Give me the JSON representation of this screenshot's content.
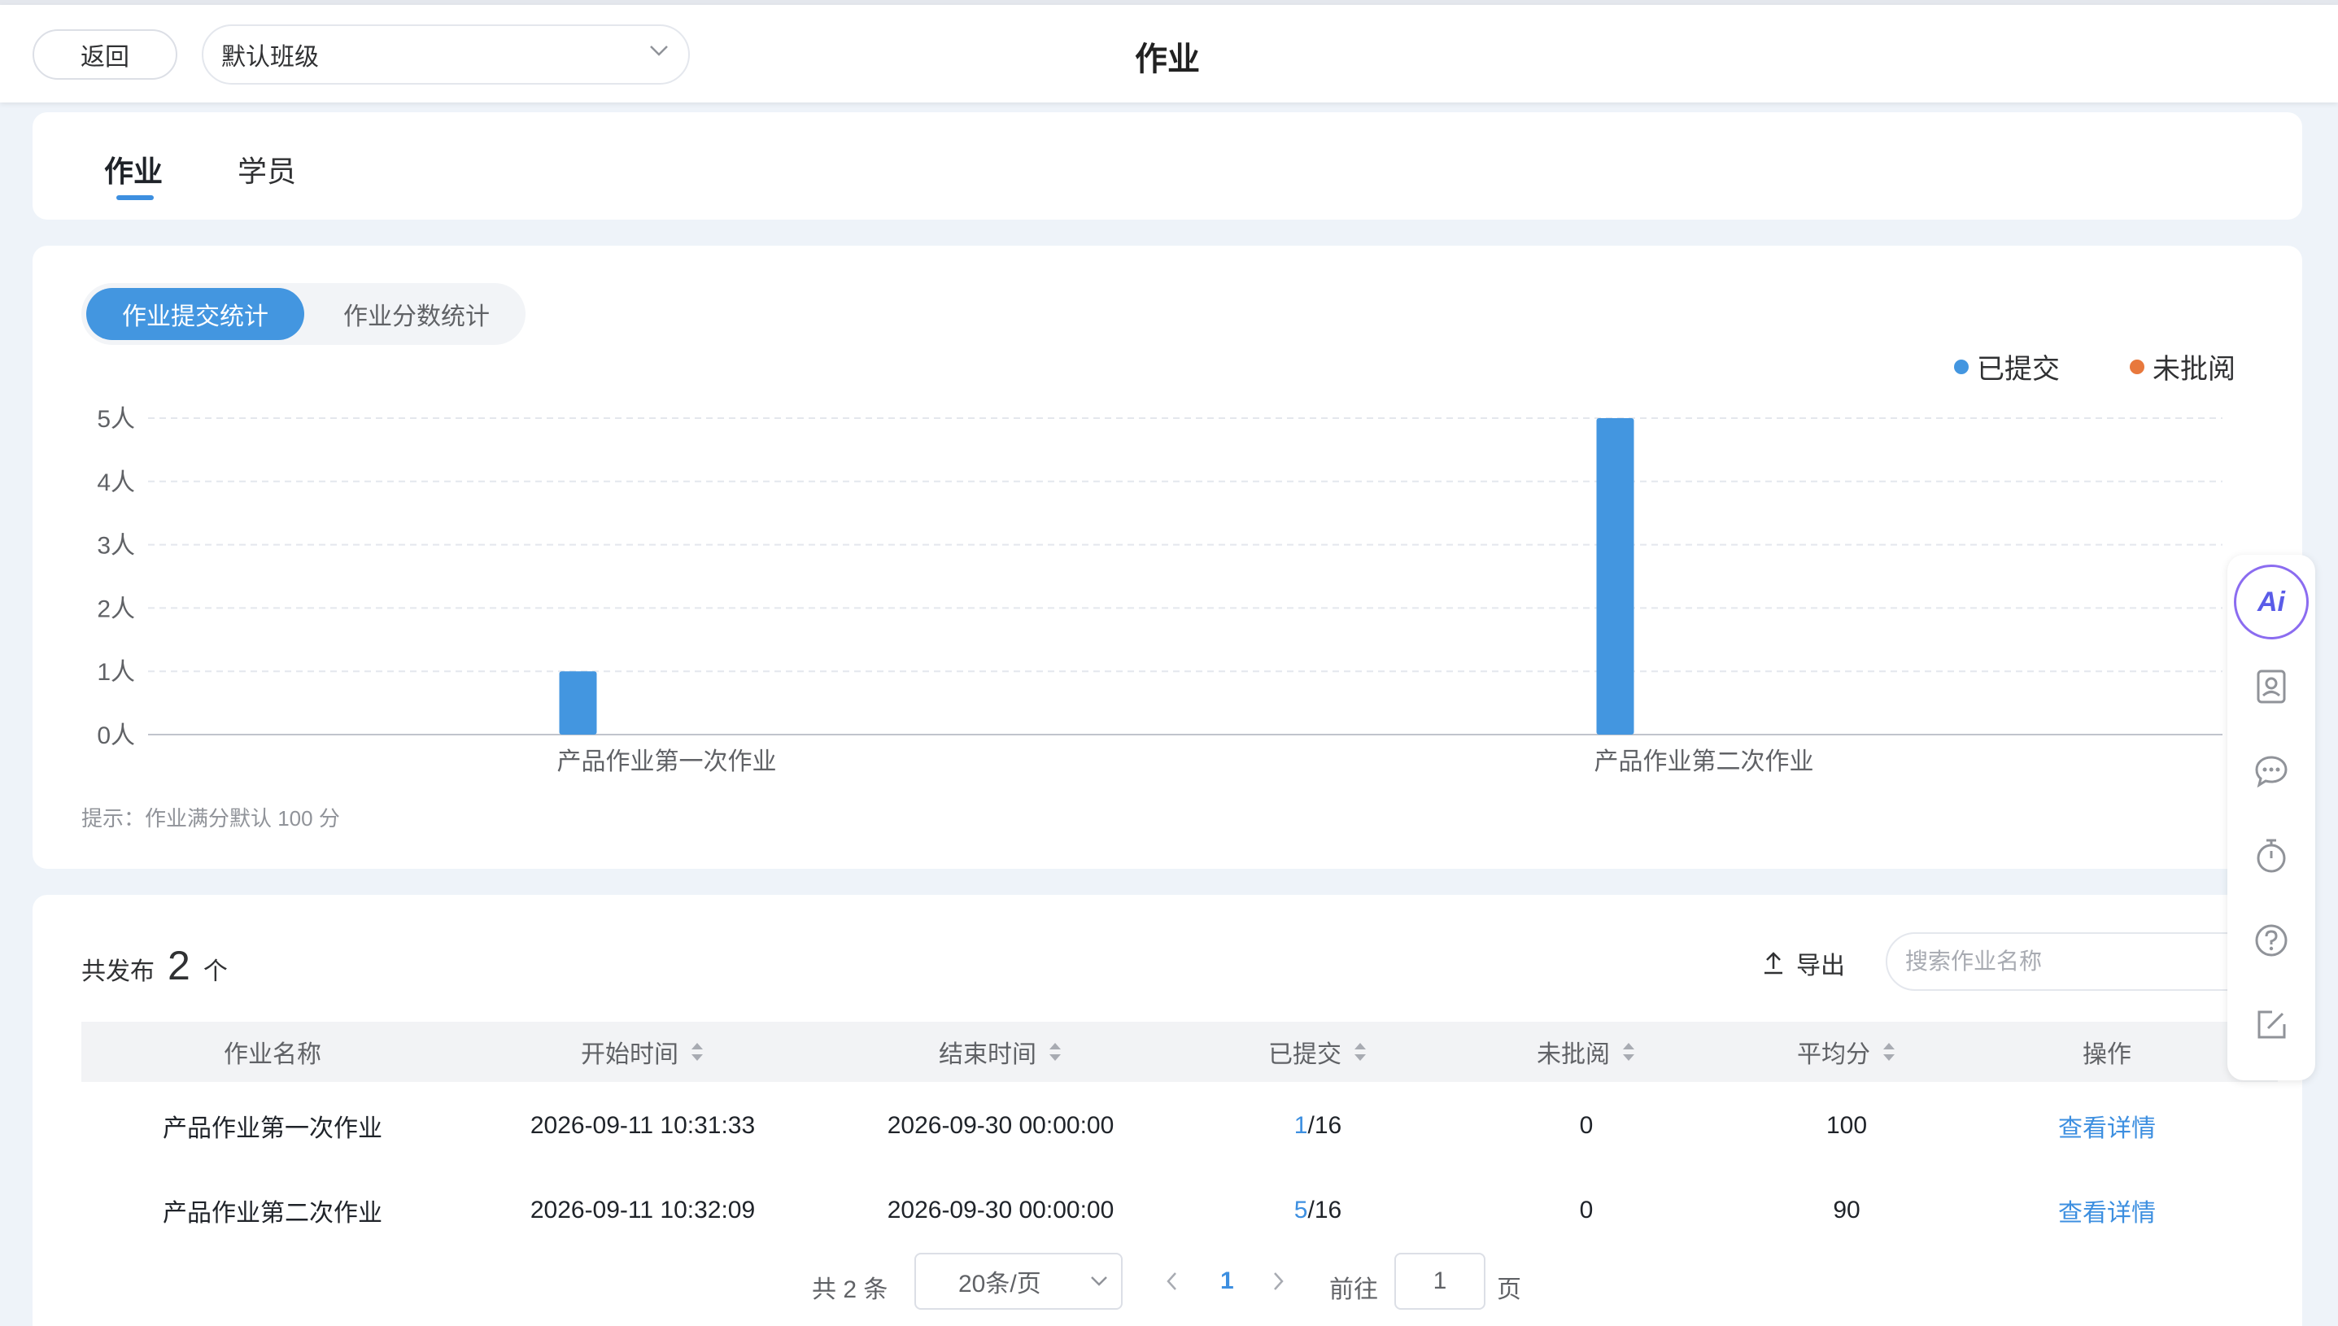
{
  "header": {
    "back_label": "返回",
    "class_select_value": "默认班级",
    "title": "作业"
  },
  "tabs": [
    {
      "label": "作业",
      "active": true
    },
    {
      "label": "学员",
      "active": false
    }
  ],
  "chart_section": {
    "toggle": [
      {
        "label": "作业提交统计",
        "active": true
      },
      {
        "label": "作业分数统计",
        "active": false
      }
    ],
    "hint": "提示：作业满分默认 100 分"
  },
  "chart_data": {
    "type": "bar",
    "categories": [
      "产品作业第一次作业",
      "产品作业第二次作业"
    ],
    "series": [
      {
        "name": "已提交",
        "values": [
          1,
          5
        ],
        "color": "#4396e0"
      },
      {
        "name": "未批阅",
        "values": [
          0,
          0
        ],
        "color": "#e8783c"
      }
    ],
    "yticks": [
      "0人",
      "1人",
      "2人",
      "3人",
      "4人",
      "5人"
    ],
    "ylim": [
      0,
      5
    ],
    "grid": true,
    "legend": "top-right"
  },
  "table_section": {
    "total_prefix": "共发布",
    "total_count": "2",
    "total_suffix": "个",
    "export_label": "导出",
    "search_placeholder": "搜索作业名称",
    "columns": [
      "作业名称",
      "开始时间",
      "结束时间",
      "已提交",
      "未批阅",
      "平均分",
      "操作"
    ],
    "rows": [
      {
        "name": "产品作业第一次作业",
        "start": "2026-09-11 10:31:33",
        "end": "2026-09-30 00:00:00",
        "submitted": "1",
        "total": "/16",
        "unreviewed": "0",
        "avg": "100",
        "action": "查看详情"
      },
      {
        "name": "产品作业第二次作业",
        "start": "2026-09-11 10:32:09",
        "end": "2026-09-30 00:00:00",
        "submitted": "5",
        "total": "/16",
        "unreviewed": "0",
        "avg": "90",
        "action": "查看详情"
      }
    ]
  },
  "pagination": {
    "total": "共 2 条",
    "page_size": "20条/页",
    "current_page": "1",
    "goto_label": "前往",
    "goto_value": "1",
    "page_suffix": "页"
  },
  "side_toolbar": {
    "ai_label": "Ai",
    "icons": [
      "ai-icon",
      "contact-card-icon",
      "chat-icon",
      "timer-icon",
      "help-icon",
      "edit-icon"
    ]
  }
}
